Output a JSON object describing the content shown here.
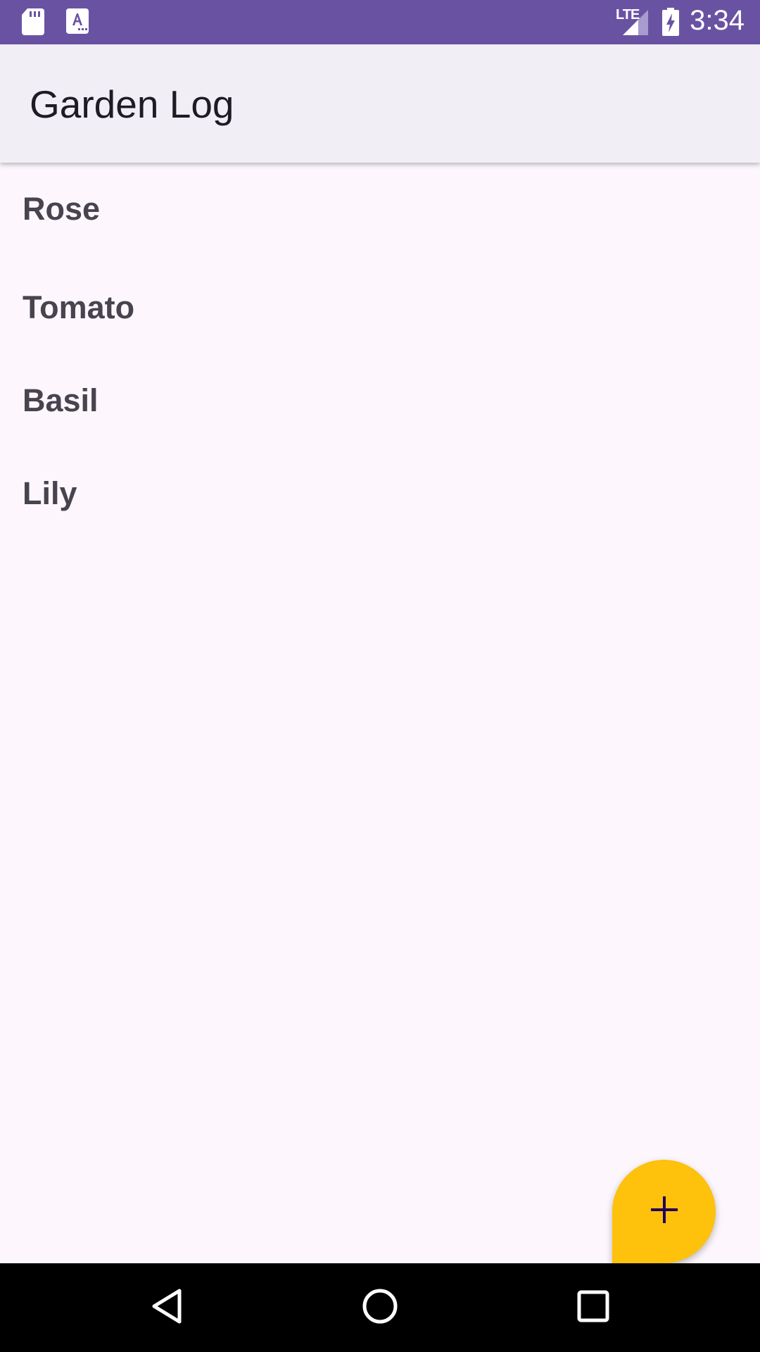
{
  "status_bar": {
    "time": "3:34",
    "network": "LTE",
    "icons": [
      "sd-card-icon",
      "text-a-icon",
      "signal-icon",
      "battery-charging-icon"
    ],
    "color": "#6a52a3"
  },
  "app_bar": {
    "title": "Garden Log",
    "background": "#f2eef6"
  },
  "plants": [
    {
      "name": "Rose"
    },
    {
      "name": "Tomato"
    },
    {
      "name": "Basil"
    },
    {
      "name": "Lily"
    }
  ],
  "fab": {
    "icon": "plus-icon",
    "color": "#fec10c"
  },
  "nav_bar": {
    "buttons": [
      "back-icon",
      "home-icon",
      "recents-icon"
    ]
  }
}
